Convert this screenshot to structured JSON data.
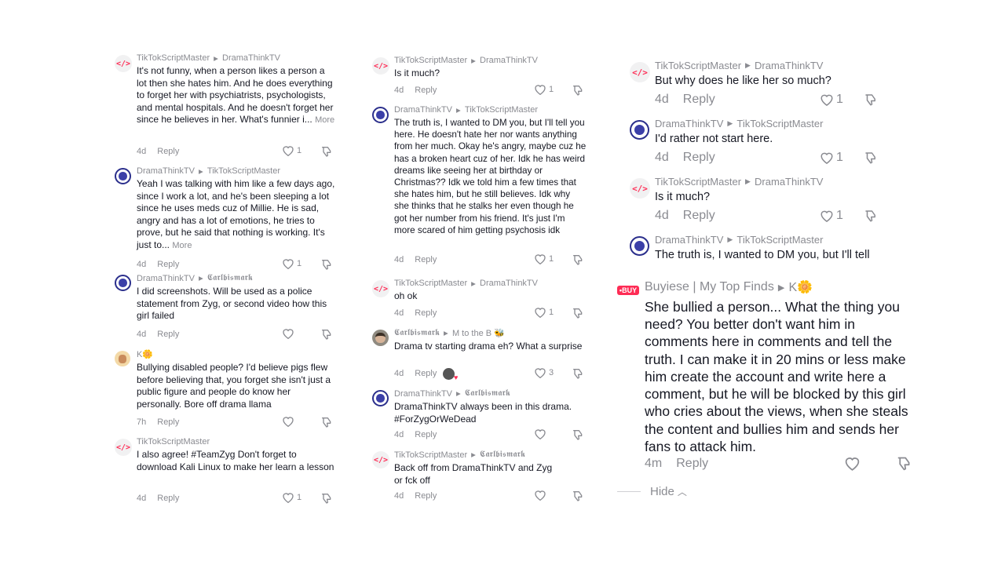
{
  "colors": {
    "accent": "#fe2c55",
    "muted": "#8a8b91",
    "text": "#161823"
  },
  "columns": [
    {
      "comments": [
        {
          "avatar": "code-avatar",
          "author": "TikTokScriptMaster",
          "reply_to": "DramaThinkTV",
          "text": "It's not funny, when a person likes a person a lot then she hates him. And he does everything to forget her with psychiatrists, psychologists, and mental hospitals. And he doesn't forget her since he believes in her. What's funnier i...",
          "more": "More",
          "time": "4d",
          "reply": "Reply",
          "likes": "1"
        },
        {
          "avatar": "drama-avatar",
          "author": "DramaThinkTV",
          "reply_to": "TikTokScriptMaster",
          "text": "Yeah I was talking with him like a few days ago, since I work a lot, and he's been sleeping a lot since he uses meds cuz of Millie. He is sad, angry and has a lot of emotions, he tries to prove, but he said that nothing is working. It's just to...",
          "more": "More",
          "time": "4d",
          "reply": "Reply",
          "likes": "1"
        },
        {
          "avatar": "drama-avatar",
          "author": "DramaThinkTV",
          "reply_to": "𝕮𝖆𝖗𝖑𝖇𝖎𝖘𝖒𝖆𝖗𝖐",
          "text": "I did screenshots. Will be used as a police statement from Zyg, or second video how this girl failed",
          "time": "4d",
          "reply": "Reply",
          "likes": ""
        },
        {
          "avatar": "k-avatar",
          "author": "K🌼",
          "reply_to": "",
          "text": "Bullying disabled people? I'd believe pigs flew before believing that, you forget she isn't just a public figure and people do know her personally. Bore off drama llama",
          "time": "7h",
          "reply": "Reply",
          "likes": ""
        },
        {
          "avatar": "code-avatar",
          "author": "TikTokScriptMaster",
          "reply_to": "",
          "text": "I also agree! #TeamZyg Don't forget to download Kali Linux to make her learn a lesson",
          "time": "4d",
          "reply": "Reply",
          "likes": "1"
        }
      ]
    },
    {
      "comments": [
        {
          "avatar": "code-avatar",
          "author": "TikTokScriptMaster",
          "reply_to": "DramaThinkTV",
          "text": "Is it much?",
          "time": "4d",
          "reply": "Reply",
          "likes": "1"
        },
        {
          "avatar": "drama-avatar",
          "author": "DramaThinkTV",
          "reply_to": "TikTokScriptMaster",
          "text": "The truth is, I wanted to DM you, but I'll tell you here. He doesn't hate her nor wants anything from her much. Okay he's angry, maybe cuz he has a broken heart cuz of her. Idk he has weird dreams like seeing her at birthday or Christmas?? Idk we told him a few times that she hates him, but he still believes. Idk why she thinks that he stalks her even though he got her number from his friend. It's just I'm more scared of him getting psychosis idk",
          "time": "4d",
          "reply": "Reply",
          "likes": "1"
        },
        {
          "avatar": "code-avatar",
          "author": "TikTokScriptMaster",
          "reply_to": "DramaThinkTV",
          "text": "oh ok",
          "time": "4d",
          "reply": "Reply",
          "likes": "1"
        },
        {
          "avatar": "man-avatar",
          "author": "𝕮𝖆𝖗𝖑𝖇𝖎𝖘𝖒𝖆𝖗𝖐",
          "reply_to": "M to the B 🐝",
          "text": "Drama tv starting drama eh? What a surprise",
          "time": "4d",
          "reply": "Reply",
          "likes": "3",
          "liked_by_creator": true
        },
        {
          "avatar": "drama-avatar",
          "author": "DramaThinkTV",
          "reply_to": "𝕮𝖆𝖗𝖑𝖇𝖎𝖘𝖒𝖆𝖗𝖐",
          "text": "DramaThinkTV always been in this drama. #ForZygOrWeDead",
          "time": "4d",
          "reply": "Reply",
          "likes": ""
        },
        {
          "avatar": "code-avatar",
          "author": "TikTokScriptMaster",
          "reply_to": "𝕮𝖆𝖗𝖑𝖇𝖎𝖘𝖒𝖆𝖗𝖐",
          "text": "Back off from DramaThinkTV and Zyg or fck off",
          "time": "4d",
          "reply": "Reply",
          "likes": ""
        }
      ]
    },
    {
      "comments": [
        {
          "avatar": "code-avatar",
          "author": "TikTokScriptMaster",
          "reply_to": "DramaThinkTV",
          "text": "But why does he like her so much?",
          "time": "4d",
          "reply": "Reply",
          "likes": "1"
        },
        {
          "avatar": "drama-avatar",
          "author": "DramaThinkTV",
          "reply_to": "TikTokScriptMaster",
          "text": "I'd rather not start here.",
          "time": "4d",
          "reply": "Reply",
          "likes": "1"
        },
        {
          "avatar": "code-avatar",
          "author": "TikTokScriptMaster",
          "reply_to": "DramaThinkTV",
          "text": "Is it much?",
          "time": "4d",
          "reply": "Reply",
          "likes": "1"
        },
        {
          "avatar": "drama-avatar",
          "author": "DramaThinkTV",
          "reply_to": "TikTokScriptMaster",
          "text": "The truth is, I wanted to DM you, but I'll tell",
          "time": "",
          "reply": "",
          "likes": ""
        }
      ],
      "featured": {
        "avatar": "buy-avatar",
        "badge": "•BUY",
        "author": "Buyiese | My Top Finds",
        "reply_to": "K🌼",
        "text": "She bullied a person... What the thing you need? You better don't want him in comments here in comments and tell the truth. I can make it in 20 mins or less make him create the account and write here a comment, but he will be blocked by this girl who cries about the views, when she steals the content and bullies him and sends her fans to attack him.",
        "time": "4m",
        "reply": "Reply",
        "likes": ""
      },
      "hide_label": "Hide",
      "hide_icon": "chevron-up-icon"
    }
  ]
}
